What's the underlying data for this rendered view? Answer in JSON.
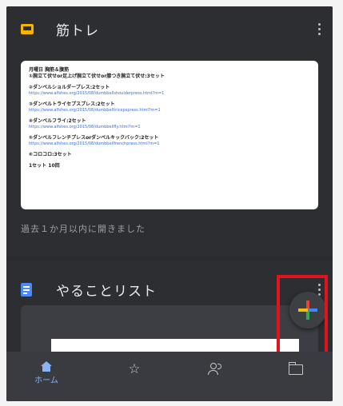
{
  "cards": [
    {
      "title": "筋トレ",
      "icon": "slides-icon",
      "preview_lines": [
        {
          "text": "月曜日 胸筋＆腹筋",
          "kind": "line"
        },
        {
          "text": "①腕立て伏せor足上げ腕立て伏せor膝つき腕立て伏せ:3セット",
          "kind": "line"
        },
        {
          "text": "",
          "kind": "gap"
        },
        {
          "text": "②ダンベルショルダープレス:2セット",
          "kind": "line"
        },
        {
          "text": "https://www.alfshes.org/2015/08/dumbbellshoulderpress.html?m=1",
          "kind": "link"
        },
        {
          "text": "",
          "kind": "gap"
        },
        {
          "text": "③ダンベルトライセプスプレス:2セット",
          "kind": "line"
        },
        {
          "text": "https://www.alfshes.org/2015/08/dumbbelltricepspress.html?m=1",
          "kind": "link"
        },
        {
          "text": "",
          "kind": "gap"
        },
        {
          "text": "④ダンベルフライ:2セット",
          "kind": "line"
        },
        {
          "text": "https://www.alfshes.org/2015/08/dumbbellfly.html?m=1",
          "kind": "link"
        },
        {
          "text": "",
          "kind": "gap"
        },
        {
          "text": "⑤ダンベルフレンチプレスorダンベルキックバック:2セット",
          "kind": "line"
        },
        {
          "text": "https://www.alfshes.org/2015/08/dumbbellfrenchpress.html?m=1",
          "kind": "link"
        },
        {
          "text": "",
          "kind": "gap"
        },
        {
          "text": "⑥コロコロ:3セット",
          "kind": "line"
        },
        {
          "text": "",
          "kind": "gap"
        },
        {
          "text": "1セット 10回",
          "kind": "line"
        }
      ],
      "opened_text": "過去１か月以内に開きました"
    },
    {
      "title": "やることリスト",
      "icon": "docs-icon"
    }
  ],
  "fab": {
    "icon": "plus-icon",
    "colors": [
      "#4285f4",
      "#ea4335",
      "#fbbc04",
      "#34a853"
    ]
  },
  "highlight_color": "#e0141e",
  "bottom_nav": [
    {
      "label": "ホーム",
      "icon": "home-icon",
      "active": true
    },
    {
      "label": "",
      "icon": "star-icon",
      "active": false
    },
    {
      "label": "",
      "icon": "shared-people-icon",
      "active": false
    },
    {
      "label": "",
      "icon": "folder-icon",
      "active": false
    }
  ]
}
